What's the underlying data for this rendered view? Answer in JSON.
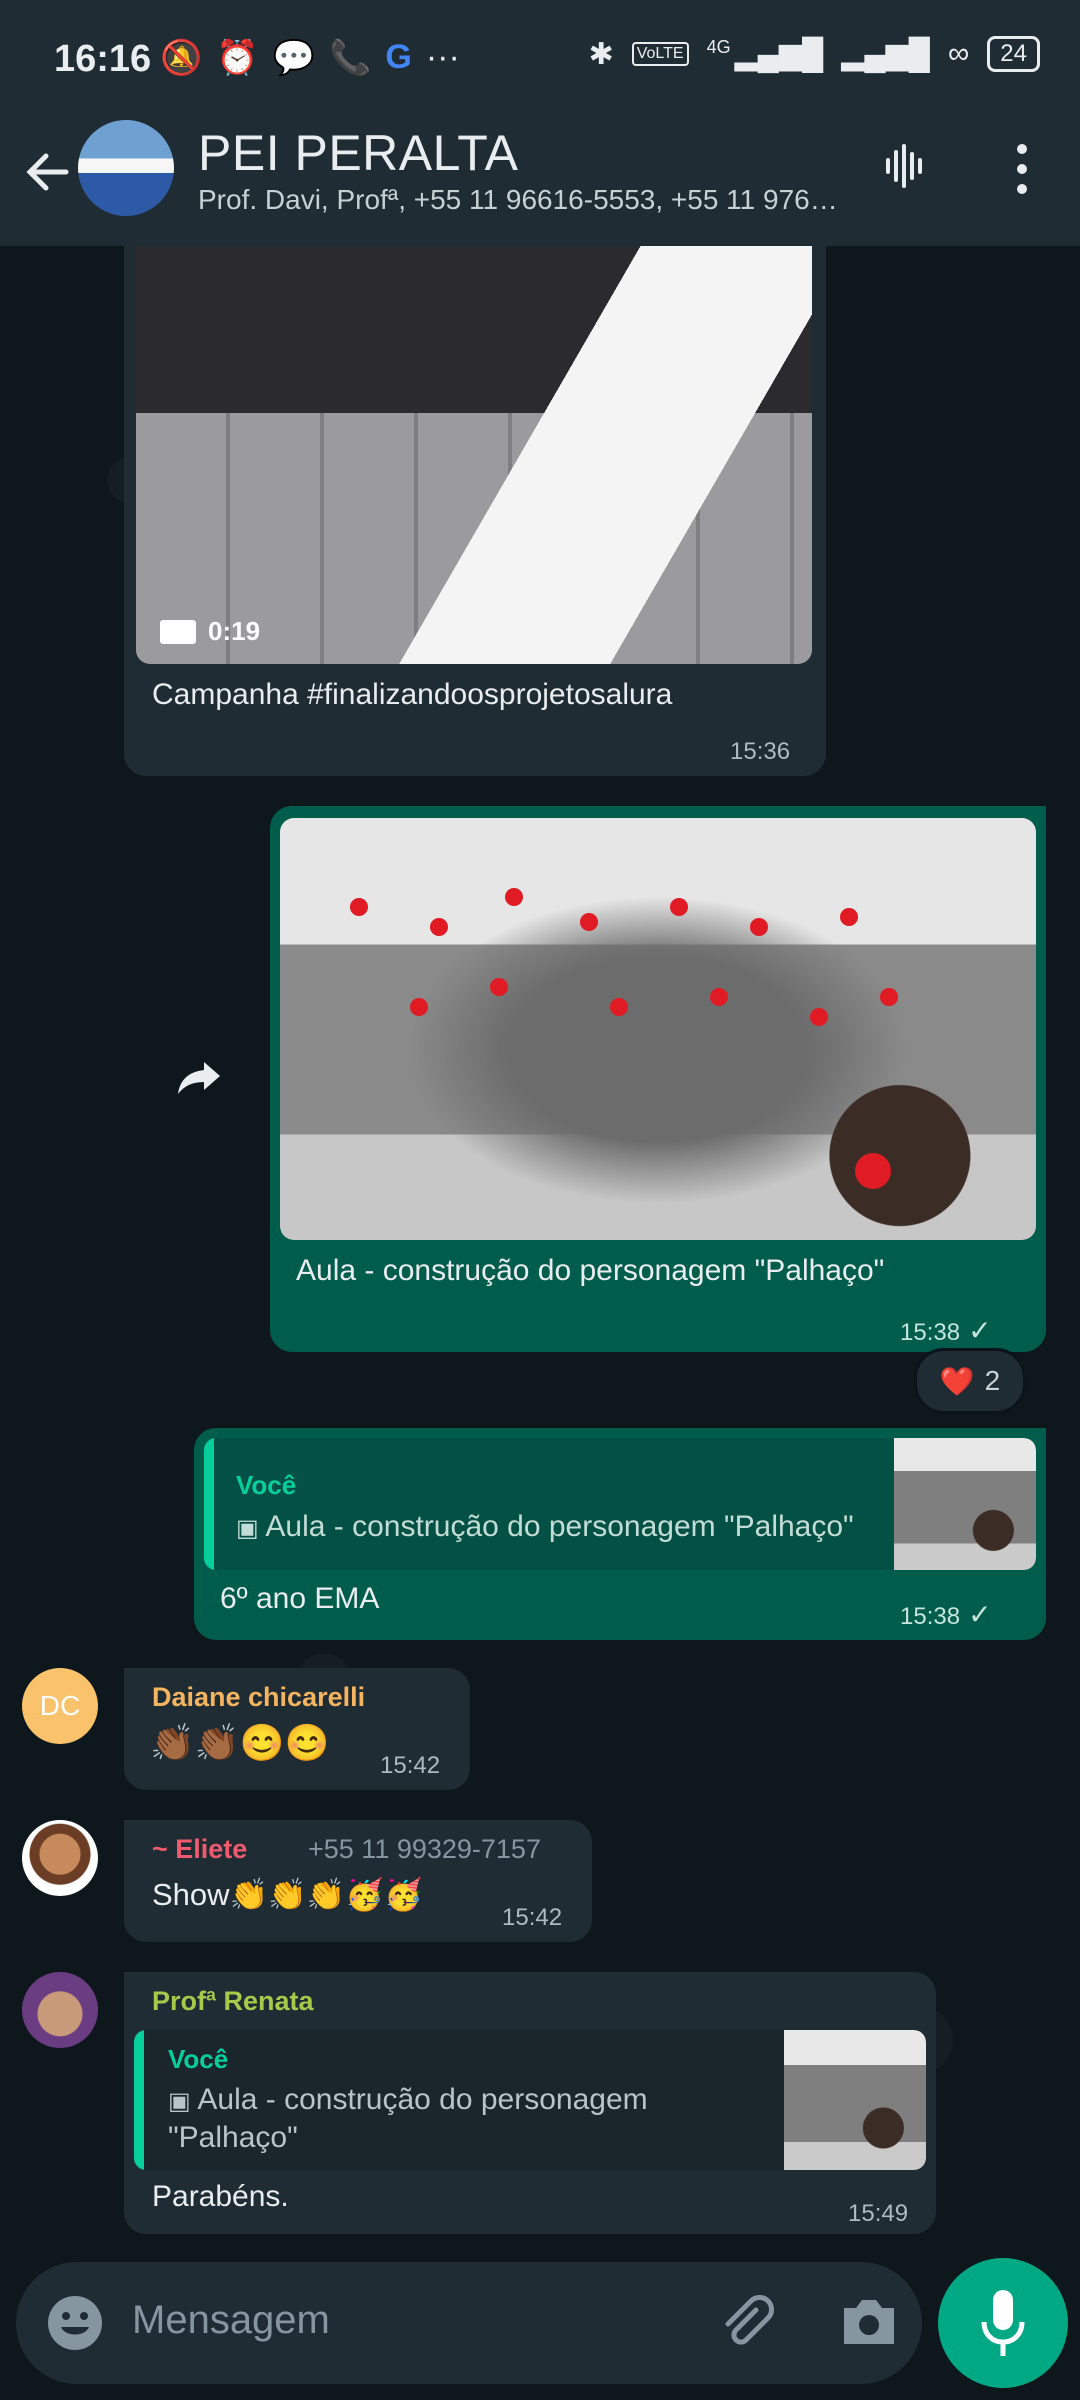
{
  "status_bar": {
    "time": "16:16",
    "left_icons": [
      "mute-bell-icon",
      "alarm-icon",
      "chat-app-icon",
      "phone-app-icon",
      "google-icon",
      "more-dots"
    ],
    "right_icons": [
      "bluetooth-icon",
      "volte-icon",
      "signal-4g-icon",
      "signal-icon",
      "link-icon"
    ],
    "network": "4G",
    "volte": "VoLTE",
    "battery": "24"
  },
  "header": {
    "title": "PEI PERALTA",
    "subtitle": "Prof. Davi, Profª, +55 11 96616-5553, +55 11 9763…"
  },
  "messages": [
    {
      "id": "video-msg",
      "direction": "in",
      "media_type": "video",
      "duration": "0:19",
      "caption": "Campanha #finalizandoosprojetosalura",
      "time": "15:36"
    },
    {
      "id": "photo-msg",
      "direction": "out",
      "media_type": "image",
      "caption": "Aula - construção do personagem \"Palhaço\"",
      "time": "15:38",
      "reaction": {
        "emoji": "❤️",
        "count": "2"
      }
    },
    {
      "id": "reply-msg",
      "direction": "out",
      "quote_author": "Você",
      "quote_text": "Aula - construção do personagem \"Palhaço\"",
      "text": "6º ano EMA",
      "time": "15:38"
    },
    {
      "id": "daiane-msg",
      "direction": "in",
      "avatar_initials": "DC",
      "sender": "Daiane chicarelli",
      "text": "👏🏾👏🏾😊😊",
      "time": "15:42"
    },
    {
      "id": "eliete-msg",
      "direction": "in",
      "sender": "~ Eliete",
      "sender_phone": "+55 11 99329-7157",
      "text": "Show👏👏👏🥳🥳",
      "time": "15:42"
    },
    {
      "id": "renata-msg",
      "direction": "in",
      "sender": "Profª Renata",
      "quote_author": "Você",
      "quote_text_line1": "Aula - construção do personagem",
      "quote_text_line2": "\"Palhaço\"",
      "text": "Parabéns.",
      "time": "15:49"
    }
  ],
  "composer": {
    "placeholder": "Mensagem"
  },
  "colors": {
    "header_bg": "#1f2c34",
    "incoming_bubble": "#202c33",
    "outgoing_bubble": "#005c4b",
    "accent": "#00a884",
    "daiane_name": "#f5b45f",
    "eliete_name": "#f05a6e",
    "renata_name": "#a6c94a"
  }
}
